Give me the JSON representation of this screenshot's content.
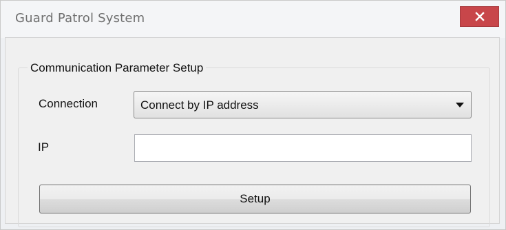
{
  "window": {
    "title": "Guard Patrol System",
    "close_glyph": "✕",
    "close_color": "#c8464a"
  },
  "groupbox": {
    "label": "Communication Parameter Setup"
  },
  "connection": {
    "label": "Connection",
    "selected_value": "Connect by IP address"
  },
  "ip": {
    "label": "IP",
    "value": "",
    "placeholder": ""
  },
  "setup_button": {
    "label": "Setup"
  }
}
